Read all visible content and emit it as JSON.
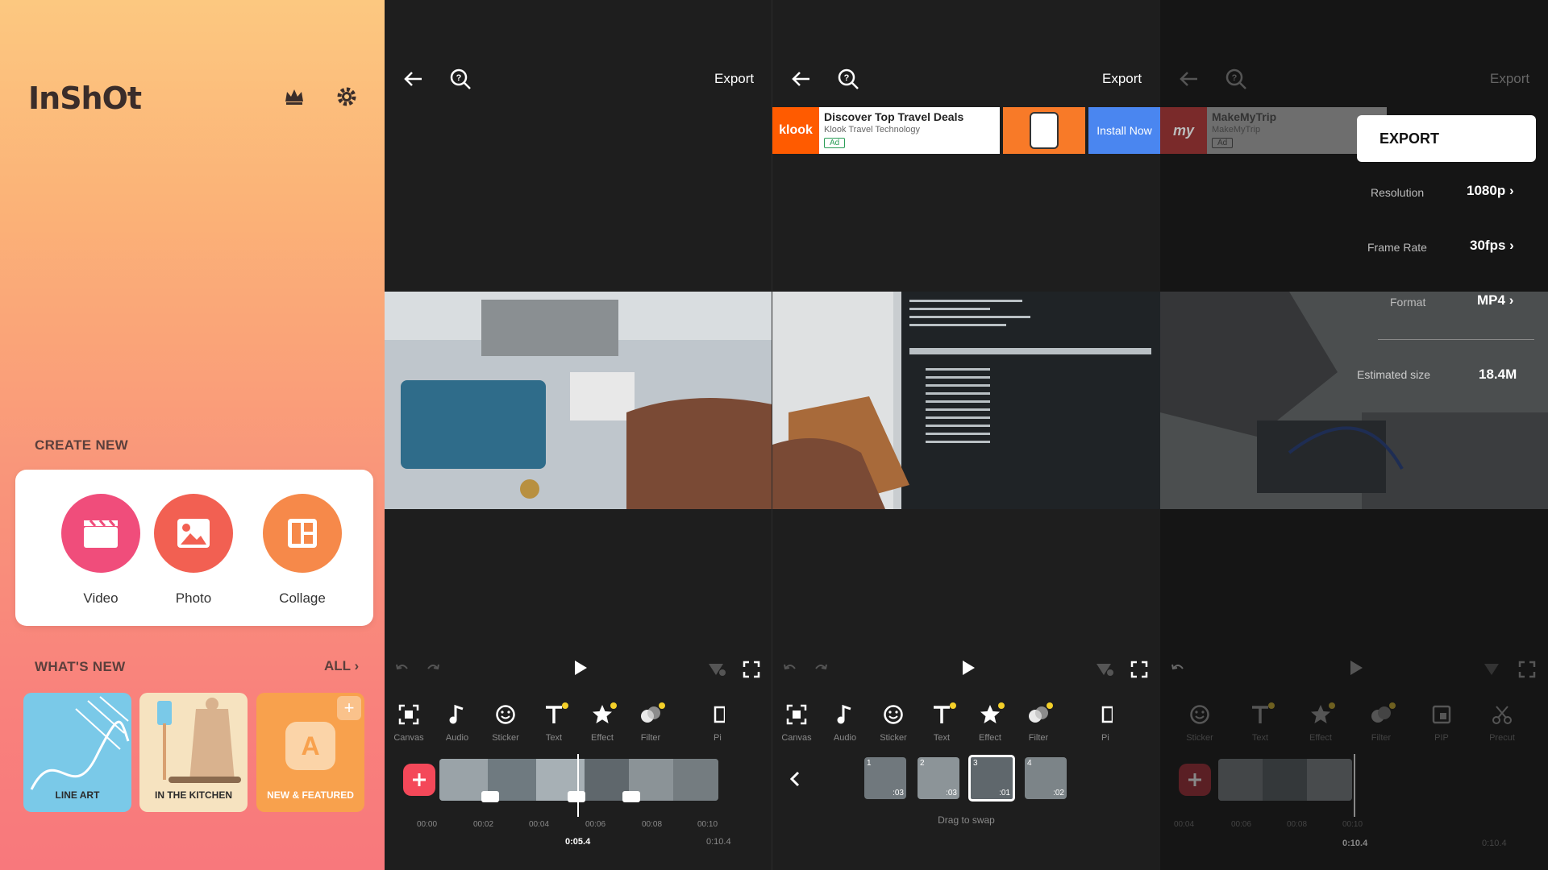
{
  "home": {
    "logo": "InShOt",
    "crown_icon": "crown-icon",
    "settings_icon": "gear-icon",
    "create_new_title": "CREATE NEW",
    "create_items": [
      {
        "label": "Video",
        "icon": "clapper-icon",
        "color": "#f04d7b"
      },
      {
        "label": "Photo",
        "icon": "photo-icon",
        "color": "#f26052"
      },
      {
        "label": "Collage",
        "icon": "collage-icon",
        "color": "#f6894a"
      }
    ],
    "whats_new_title": "WHAT'S NEW",
    "all_label": "ALL",
    "new_cards": [
      {
        "label": "LINE ART",
        "color": "#7ac9e8"
      },
      {
        "label": "IN THE KITCHEN",
        "color": "#f6e3c0"
      },
      {
        "label": "NEW & FEATURED",
        "color": "#f8a14d"
      }
    ]
  },
  "editor1": {
    "export_label": "Export",
    "tools": [
      "Canvas",
      "Audio",
      "Sticker",
      "Text",
      "Effect",
      "Filter",
      "Pi"
    ],
    "time_ticks": [
      "00:00",
      "00:02",
      "00:04",
      "00:06",
      "00:08",
      "00:10"
    ],
    "current_time": "0:05.4",
    "total_time": "0:10.4"
  },
  "editor2": {
    "export_label": "Export",
    "ad": {
      "title": "Discover Top Travel Deals",
      "subtitle": "Klook Travel Technology",
      "badge": "Ad",
      "brand": "klook",
      "cta": "Install Now"
    },
    "tools": [
      "Canvas",
      "Audio",
      "Sticker",
      "Text",
      "Effect",
      "Filter",
      "Pi"
    ],
    "clips": [
      {
        "index": "1",
        "duration": ":03"
      },
      {
        "index": "2",
        "duration": ":03"
      },
      {
        "index": "3",
        "duration": ":01"
      },
      {
        "index": "4",
        "duration": ":02"
      }
    ],
    "hint": "Drag to swap"
  },
  "editor3": {
    "export_label": "Export",
    "ad": {
      "title": "MakeMyTrip",
      "subtitle": "MakeMyTrip",
      "badge": "Ad",
      "brand": "my"
    },
    "export_panel": {
      "title": "EXPORT",
      "rows": [
        {
          "label": "Resolution",
          "value": "1080p"
        },
        {
          "label": "Frame Rate",
          "value": "30fps"
        },
        {
          "label": "Format",
          "value": "MP4"
        }
      ],
      "estimated_label": "Estimated size",
      "estimated_value": "18.4M"
    },
    "tools": [
      "Sticker",
      "Text",
      "Effect",
      "Filter",
      "PIP",
      "Precut"
    ],
    "time_ticks": [
      "00:04",
      "00:06",
      "00:08",
      "00:10"
    ],
    "current_time": "0:10.4",
    "total_time": "0:10.4"
  }
}
